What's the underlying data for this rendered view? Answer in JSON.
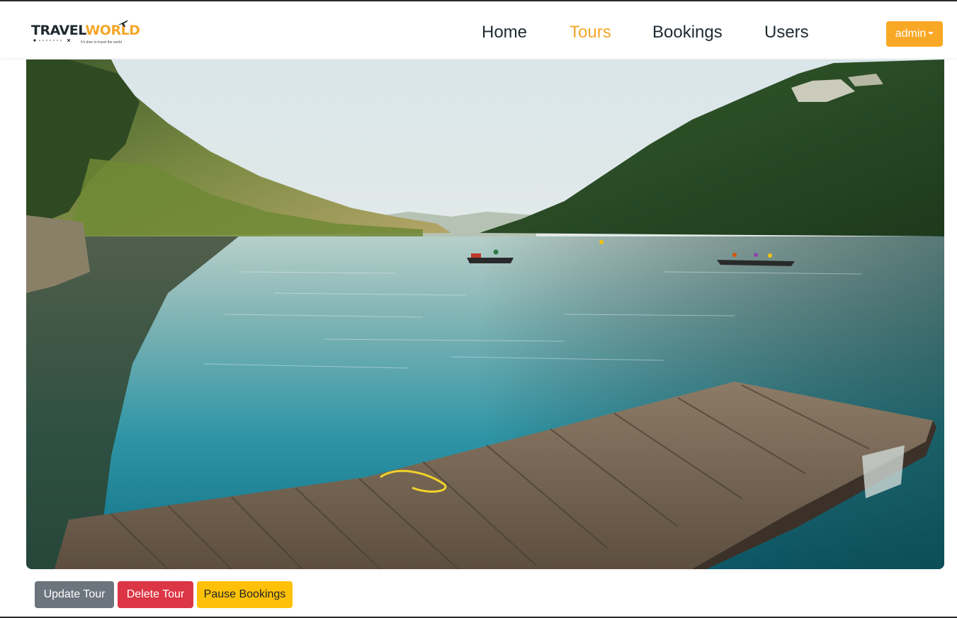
{
  "brand": {
    "name_part1": "TRAVEL",
    "name_part2": "WORLD",
    "tagline": "It's time to travel the world",
    "logo_icon": "airplane-icon",
    "accent_color": "#f4a72a"
  },
  "nav": {
    "items": [
      {
        "label": "Home",
        "active": false
      },
      {
        "label": "Tours",
        "active": true
      },
      {
        "label": "Bookings",
        "active": false
      },
      {
        "label": "Users",
        "active": false
      }
    ],
    "active_color": "#f4a72a"
  },
  "user_menu": {
    "label": "admin",
    "icon": "caret-down-icon",
    "color": "#f9a825"
  },
  "tour": {
    "image_description": "lake-with-wooden-dock-and-boats-between-forested-hills"
  },
  "actions": {
    "update_label": "Update Tour",
    "delete_label": "Delete Tour",
    "pause_label": "Pause Bookings",
    "colors": {
      "update": "#6c757d",
      "delete": "#dc3545",
      "pause": "#ffc107"
    }
  }
}
